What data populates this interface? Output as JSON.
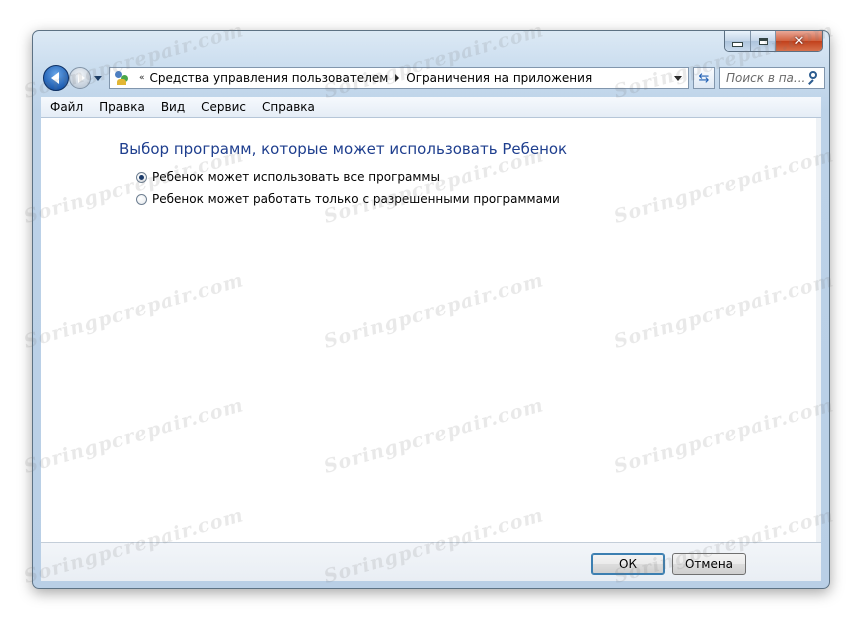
{
  "window": {
    "controls": {
      "minimize": "minimize",
      "maximize": "maximize",
      "close": "close"
    }
  },
  "address_bar": {
    "overflow": "«",
    "breadcrumbs": [
      "Средства управления пользователем",
      "Ограничения на приложения"
    ]
  },
  "search": {
    "placeholder": "Поиск в па..."
  },
  "menu": {
    "items": [
      {
        "label": "Файл"
      },
      {
        "label": "Правка"
      },
      {
        "label": "Вид"
      },
      {
        "label": "Сервис"
      },
      {
        "label": "Справка"
      }
    ]
  },
  "main": {
    "heading": "Выбор программ, которые может использовать Ребенок",
    "options": [
      {
        "label": "Ребенок может использовать все программы",
        "checked": true
      },
      {
        "label": "Ребенок может работать только с разрешенными программами",
        "checked": false
      }
    ]
  },
  "footer": {
    "ok_label": "ОК",
    "cancel_label": "Отмена"
  },
  "watermark": {
    "text": "Soringpcrepair.com"
  },
  "colors": {
    "heading": "#1e3e8e",
    "accent": "#1f5fb4"
  },
  "icons": {
    "back": "back-arrow-icon",
    "forward": "forward-arrow-icon",
    "address": "users-icon",
    "refresh": "refresh-icon",
    "search": "search-icon"
  }
}
